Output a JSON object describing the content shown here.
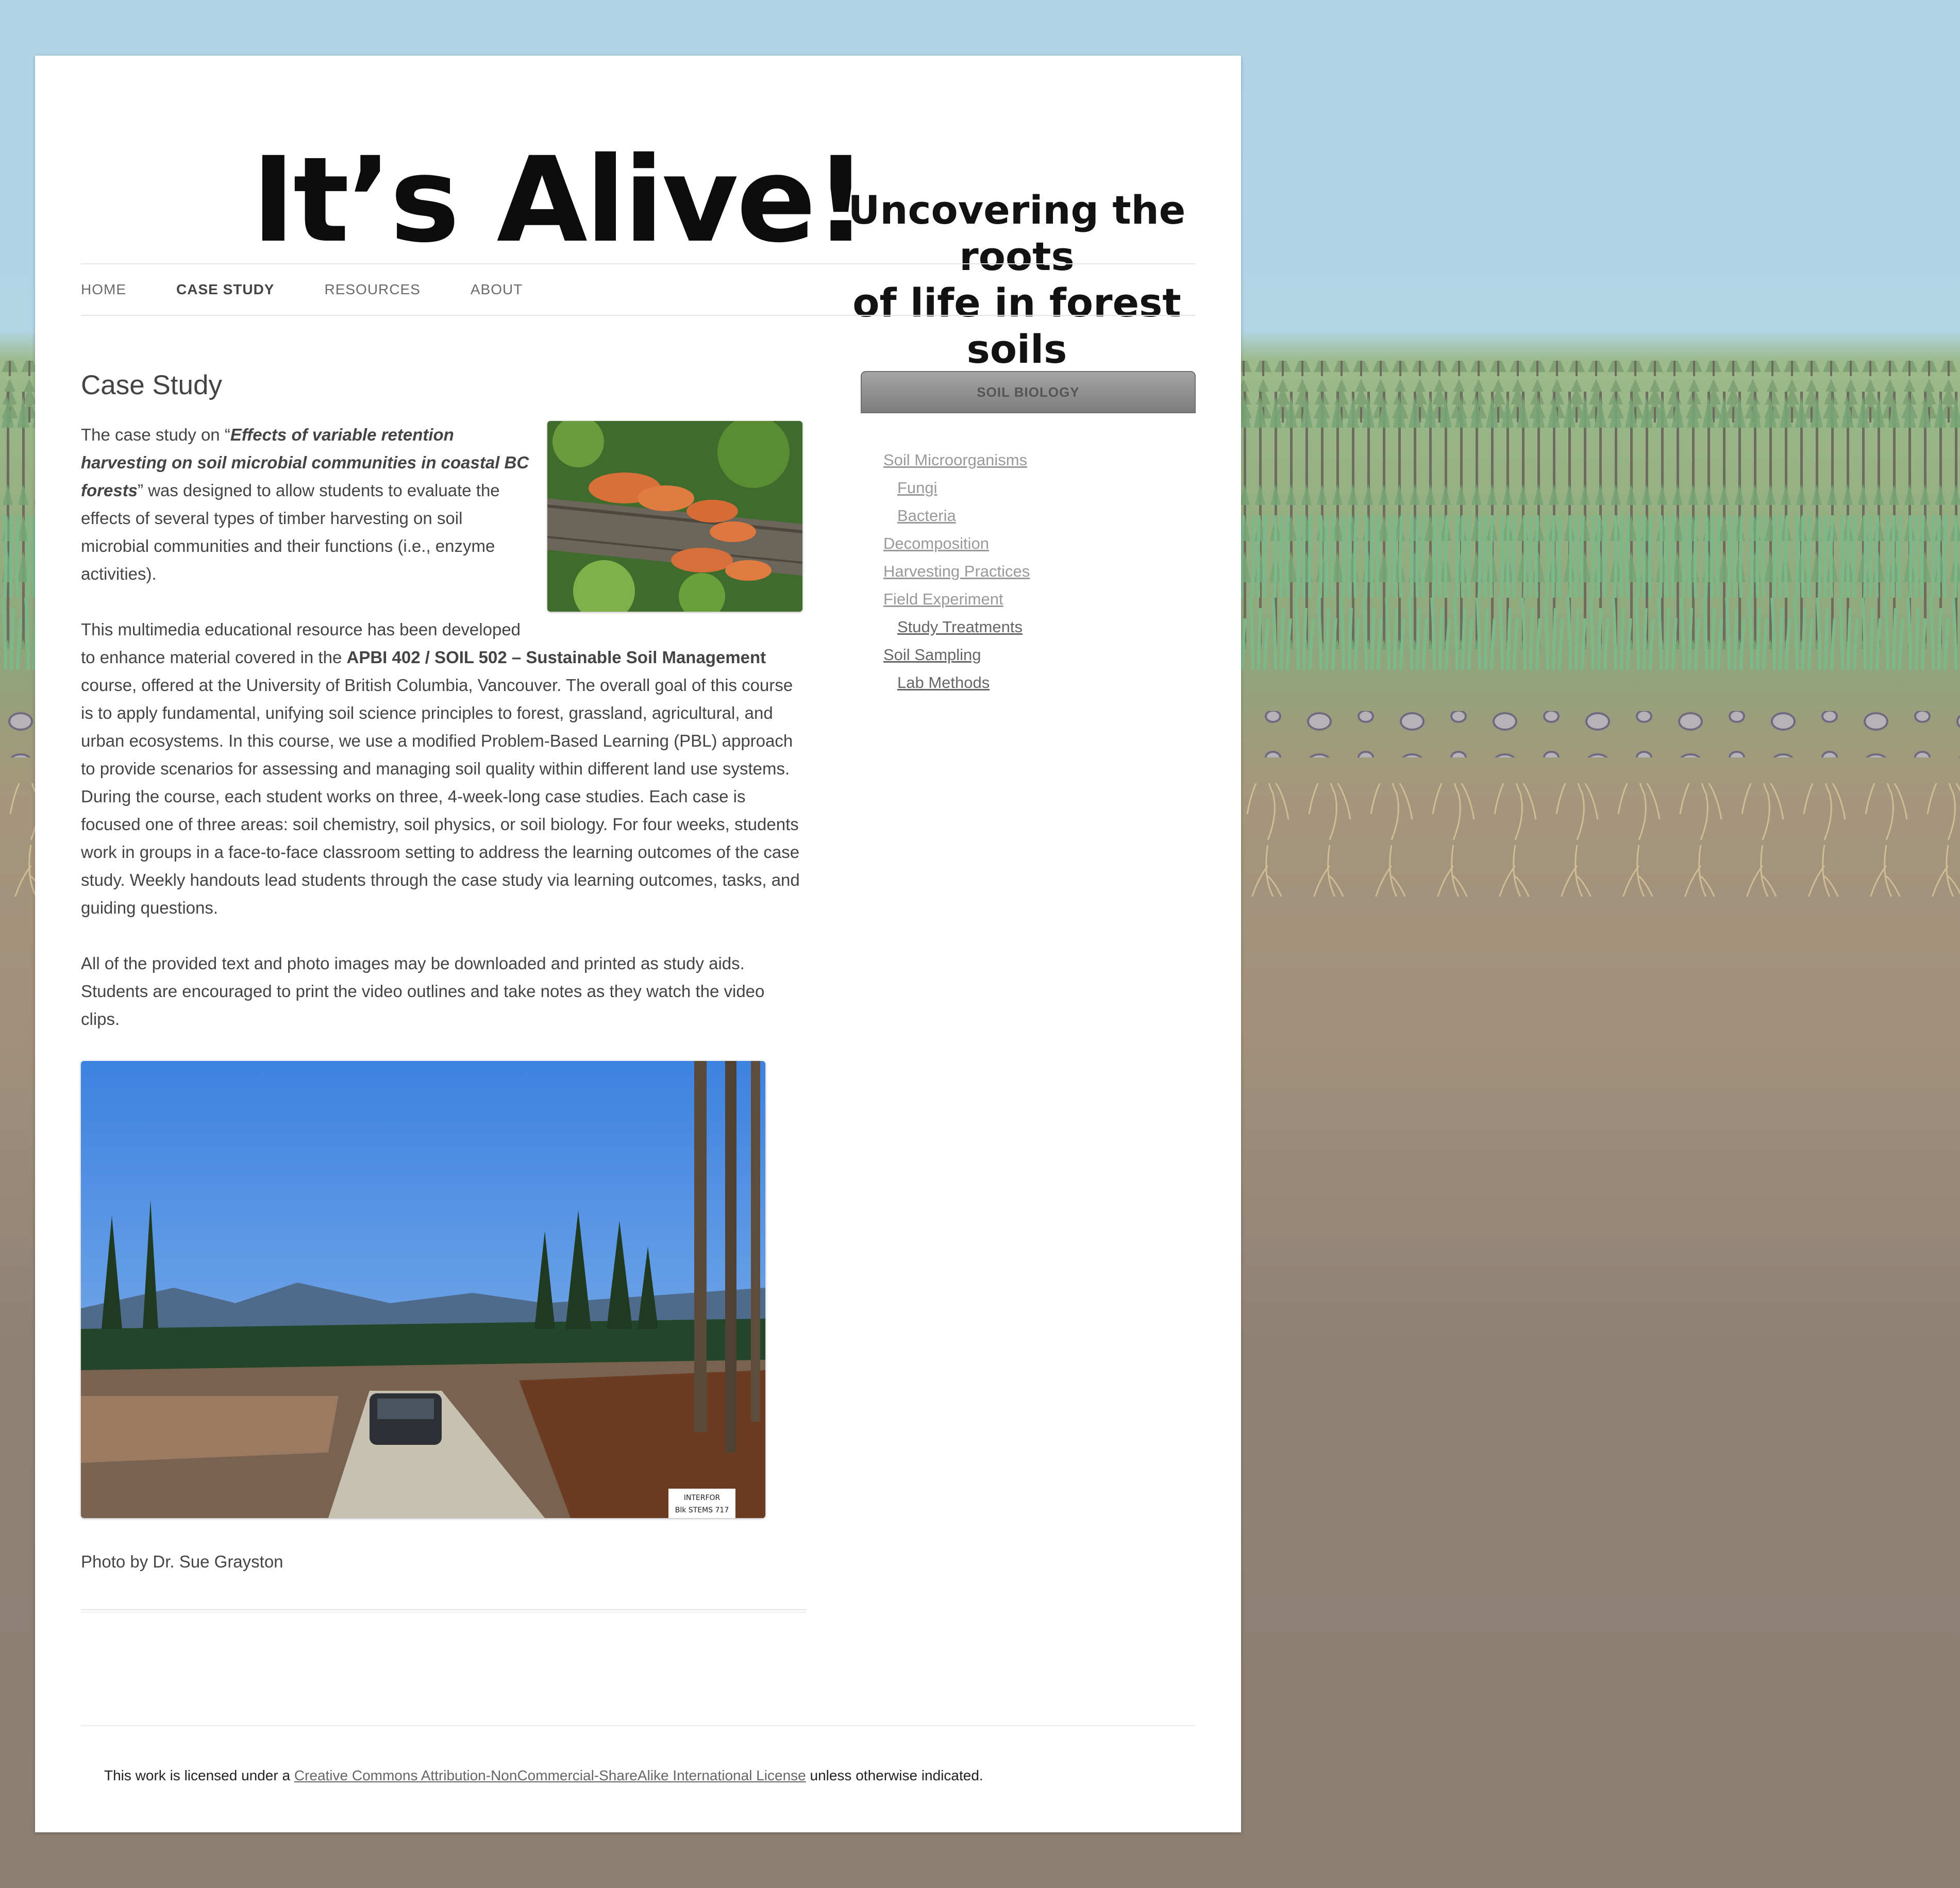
{
  "header": {
    "logo_main": "It’s Alive!",
    "logo_tag_line1": "Uncovering the roots",
    "logo_tag_line2": "of life in forest soils"
  },
  "nav": {
    "items": [
      "HOME",
      "CASE STUDY",
      "RESOURCES",
      "ABOUT"
    ],
    "active": "CASE STUDY"
  },
  "page": {
    "title": "Case Study",
    "p1_a": "The case study on “",
    "p1_bold": "Effects of variable retention harvesting on soil microbial communities in coastal BC forests",
    "p1_b": "” was designed to allow students to evaluate the effects of several types of timber harvesting on soil microbial communities and their functions (i.e., enzyme activities).",
    "p2_a": "This multimedia educational resource has been developed to enhance material covered in the ",
    "p2_bold": "APBI 402 / SOIL 502 – Sustainable Soil Management",
    "p2_b": " course, offered at the University of British Columbia, Vancouver. The overall goal of this course is to apply fundamental, unifying soil science principles to forest, grassland, agricultural, and urban ecosystems. In this course, we use a modified Problem-Based Learning (PBL) approach to provide scenarios for assessing and managing soil quality within different land use systems. During the course, each student works on three, 4-week-long case studies. Each case is focused one of three areas: soil chemistry, soil physics, or soil biology. For four weeks, students work in groups in a face-to-face classroom setting to address the learning outcomes of the case study. Weekly handouts lead students through the case study via learning outcomes, tasks, and guiding questions.",
    "p3": "All of the provided text and photo images may be downloaded and printed as study aids. Students are encouraged to print the video outlines and take notes as they watch the video clips.",
    "caption": "Photo by Dr. Sue Grayston",
    "sign_text_1": "INTERFOR",
    "sign_text_2": "Blk STEMS 717"
  },
  "sidebar": {
    "title": "SOIL BIOLOGY",
    "links": [
      {
        "label": "Soil Microorganisms"
      },
      {
        "label": "Fungi"
      },
      {
        "label": "Bacteria"
      },
      {
        "label": "Decomposition"
      },
      {
        "label": "Harvesting Practices"
      },
      {
        "label": "Field Experiment"
      },
      {
        "label": "Study Treatments"
      },
      {
        "label": "Soil Sampling"
      },
      {
        "label": "Lab Methods"
      }
    ]
  },
  "footer": {
    "text_a": "This work is licensed under a ",
    "link": "Creative Commons Attribution-NonCommercial-ShareAlike International License",
    "text_b": " unless otherwise indicated."
  },
  "colors": {
    "sky": "#b0d3e6",
    "soil": "#8f8275",
    "widget_header": "#8a8a8a",
    "link_muted": "#999999"
  }
}
